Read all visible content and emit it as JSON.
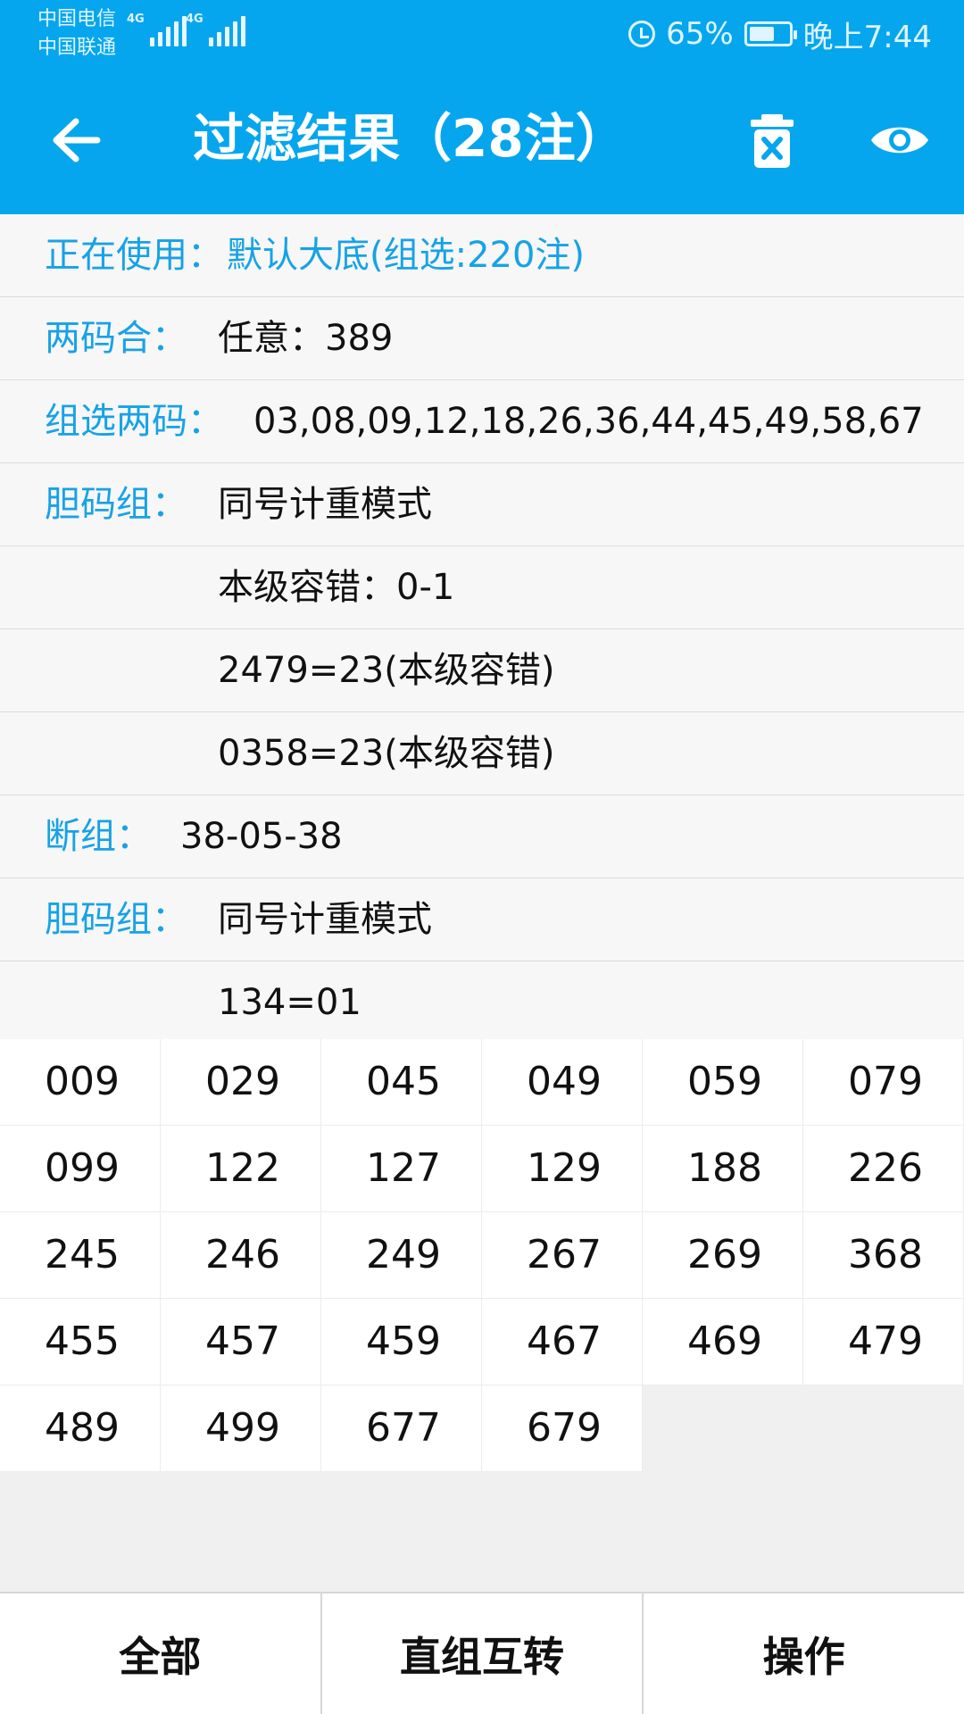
{
  "status_bar": {
    "carrier_1": "中国电信",
    "carrier_2": "中国联通",
    "network_1": "4G",
    "network_2": "4G",
    "battery_percent": "65%",
    "battery_level": 0.65,
    "time": "晚上7:44",
    "icons": [
      "signal-icon",
      "alarm-icon",
      "battery-icon"
    ]
  },
  "header": {
    "title": "过滤结果（28注）",
    "icons": [
      "back-arrow-icon",
      "trash-icon",
      "eye-icon"
    ],
    "accent_color": "#06a6ee"
  },
  "info_rows": [
    {
      "label": "正在使用：",
      "value": "默认大底(组选:220注)",
      "value_color": "#17a2e6"
    },
    {
      "label": "两码合：",
      "value": "任意：389"
    },
    {
      "label": "组选两码：",
      "value": "03,08,09,12,18,26,36,44,45,49,58,67"
    },
    {
      "label": "胆码组：",
      "value": "同号计重模式"
    },
    {
      "label": "",
      "value": "本级容错：0-1"
    },
    {
      "label": "",
      "value": "2479=23(本级容错)"
    },
    {
      "label": "",
      "value": "0358=23(本级容错)"
    },
    {
      "label": "断组：",
      "value": "38-05-38"
    },
    {
      "label": "胆码组：",
      "value": "同号计重模式"
    },
    {
      "label": "",
      "value": "134=01"
    }
  ],
  "results": [
    "009",
    "029",
    "045",
    "049",
    "059",
    "079",
    "099",
    "122",
    "127",
    "129",
    "188",
    "226",
    "245",
    "246",
    "249",
    "267",
    "269",
    "368",
    "455",
    "457",
    "459",
    "467",
    "469",
    "479",
    "489",
    "499",
    "677",
    "679"
  ],
  "bottom_tabs": [
    "全部",
    "直组互转",
    "操作"
  ]
}
